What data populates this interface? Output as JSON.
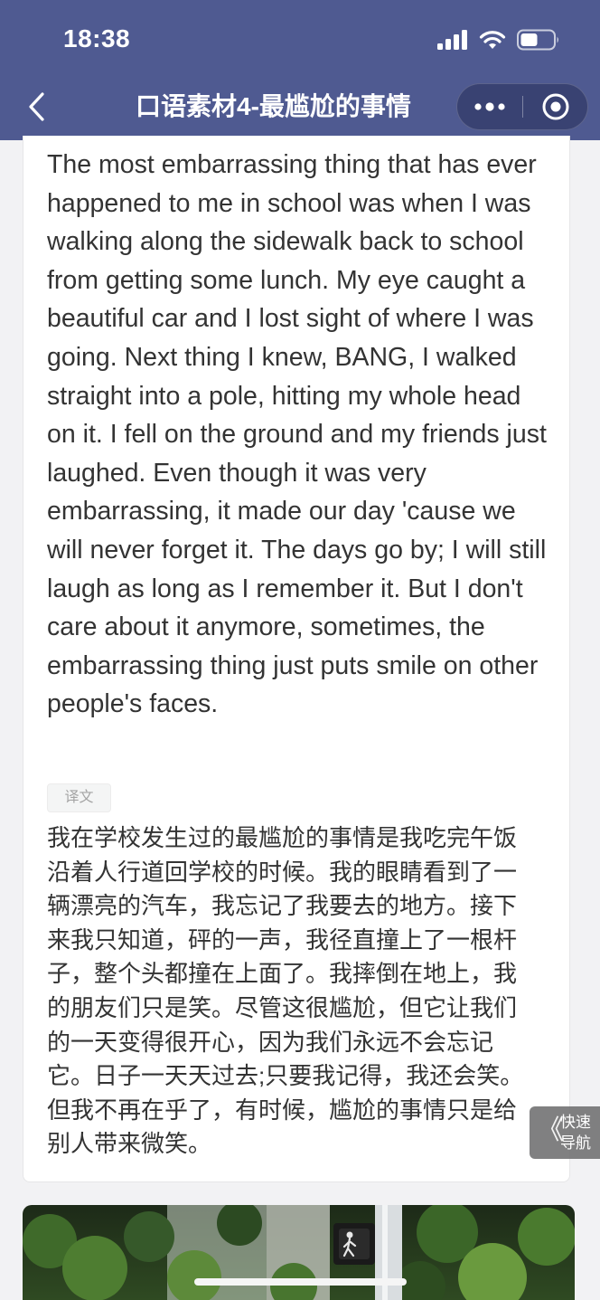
{
  "status_bar": {
    "time": "18:38"
  },
  "nav": {
    "title": "口语素材4-最尴尬的事情",
    "back_icon": "chevron-left-icon",
    "more_icon": "more-dots-icon",
    "close_icon": "target-circle-icon"
  },
  "article": {
    "english_text": "The most embarrassing thing that has ever happened to me in school was when I was walking along the sidewalk back to school from getting some lunch. My eye caught a beautiful car and I lost sight of where I was going. Next thing I knew, BANG, I walked straight into a pole, hitting my whole head on it. I fell on the ground and my friends just laughed. Even though it was very embarrassing, it made our day 'cause we will never forget it. The days go by; I will still laugh as long as I remember it. But I don't care about it anymore, sometimes, the embarrassing thing just puts smile on other people's faces.",
    "translation_tag": "译文",
    "chinese_text": "我在学校发生过的最尴尬的事情是我吃完午饭沿着人行道回学校的时候。我的眼睛看到了一辆漂亮的汽车，我忘记了我要去的地方。接下来我只知道，砰的一声，我径直撞上了一根杆子，整个头都撞在上面了。我摔倒在地上，我的朋友们只是笑。尽管这很尴尬，但它让我们的一天变得很开心，因为我们永远不会忘记它。日子一天天过去;只要我记得，我还会笑。但我不再在乎了，有时候，尴尬的事情只是给别人带来微笑。"
  },
  "quick_nav": {
    "chevron": "《",
    "label_line1": "快速",
    "label_line2": "导航"
  },
  "colors": {
    "header_bg": "#4f5a91",
    "page_bg": "#f2f2f4",
    "text": "#333333"
  }
}
